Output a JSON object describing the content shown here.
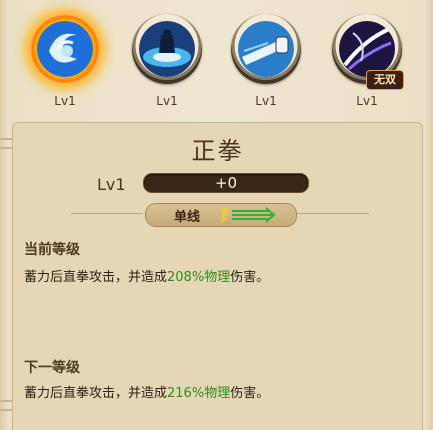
{
  "skills": [
    {
      "level": "Lv1",
      "icon": "whirlwind-icon",
      "selected": true
    },
    {
      "level": "Lv1",
      "icon": "shockwave-icon",
      "selected": false
    },
    {
      "level": "Lv1",
      "icon": "punch-icon",
      "selected": false
    },
    {
      "level": "Lv1",
      "icon": "slash-icon",
      "selected": false,
      "badge": "无双"
    }
  ],
  "detail": {
    "title": "正拳",
    "level_label": "Lv1",
    "progress_value": "+0",
    "progress_fraction": 0.0,
    "type_tag": "单线",
    "current_header": "当前等级",
    "current_desc_pre": "蓄力后直拳攻击，并造成",
    "current_value": "208%",
    "current_type": "物理",
    "current_desc_post": "伤害。",
    "next_header": "下一等级",
    "next_desc_pre": "蓄力后直拳攻击，并造成",
    "next_value": "216%",
    "next_type": "物理",
    "next_desc_post": "伤害。"
  },
  "colors": {
    "accent_green": "#2f8a1c",
    "selected_glow": "#ffb000"
  }
}
